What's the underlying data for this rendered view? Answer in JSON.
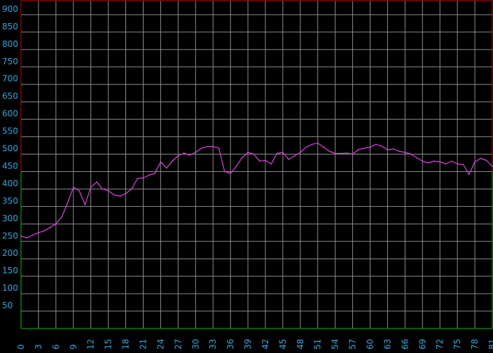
{
  "chart_data": {
    "type": "line",
    "title": "",
    "xlabel": "",
    "ylabel": "",
    "xlim": [
      0,
      81
    ],
    "ylim": [
      0,
      940
    ],
    "grid": true,
    "legend": "none",
    "x_ticks": [
      0,
      3,
      6,
      9,
      12,
      15,
      18,
      21,
      24,
      27,
      30,
      33,
      36,
      39,
      42,
      45,
      48,
      51,
      54,
      57,
      60,
      63,
      66,
      69,
      72,
      75,
      78,
      81
    ],
    "y_ticks": [
      50,
      100,
      150,
      200,
      250,
      300,
      350,
      400,
      450,
      500,
      550,
      600,
      650,
      700,
      750,
      800,
      850,
      900
    ],
    "series": [
      {
        "color": "#e040e0",
        "x": [
          0,
          1,
          2,
          3,
          4,
          5,
          6,
          7,
          8,
          9,
          10,
          11,
          12,
          13,
          14,
          15,
          16,
          17,
          18,
          19,
          20,
          21,
          22,
          23,
          24,
          25,
          26,
          27,
          28,
          29,
          30,
          31,
          32,
          33,
          34,
          35,
          36,
          37,
          38,
          39,
          40,
          41,
          42,
          43,
          44,
          45,
          46,
          47,
          48,
          49,
          50,
          51,
          52,
          53,
          54,
          55,
          56,
          57,
          58,
          59,
          60,
          61,
          62,
          63,
          64,
          65,
          66,
          67,
          68,
          69,
          70,
          71,
          72,
          73,
          74,
          75,
          76,
          77,
          78,
          79,
          80,
          81
        ],
        "values": [
          265,
          260,
          268,
          275,
          280,
          290,
          300,
          320,
          360,
          405,
          395,
          355,
          405,
          420,
          400,
          395,
          383,
          380,
          387,
          400,
          430,
          432,
          440,
          445,
          478,
          460,
          480,
          495,
          503,
          497,
          505,
          517,
          522,
          522,
          517,
          450,
          445,
          465,
          490,
          505,
          500,
          480,
          482,
          472,
          502,
          505,
          485,
          495,
          505,
          520,
          528,
          532,
          520,
          508,
          502,
          502,
          503,
          500,
          513,
          517,
          520,
          528,
          523,
          512,
          515,
          508,
          505,
          500,
          490,
          480,
          475,
          480,
          478,
          472,
          480,
          472,
          470,
          442,
          478,
          488,
          482,
          465
        ]
      }
    ]
  }
}
